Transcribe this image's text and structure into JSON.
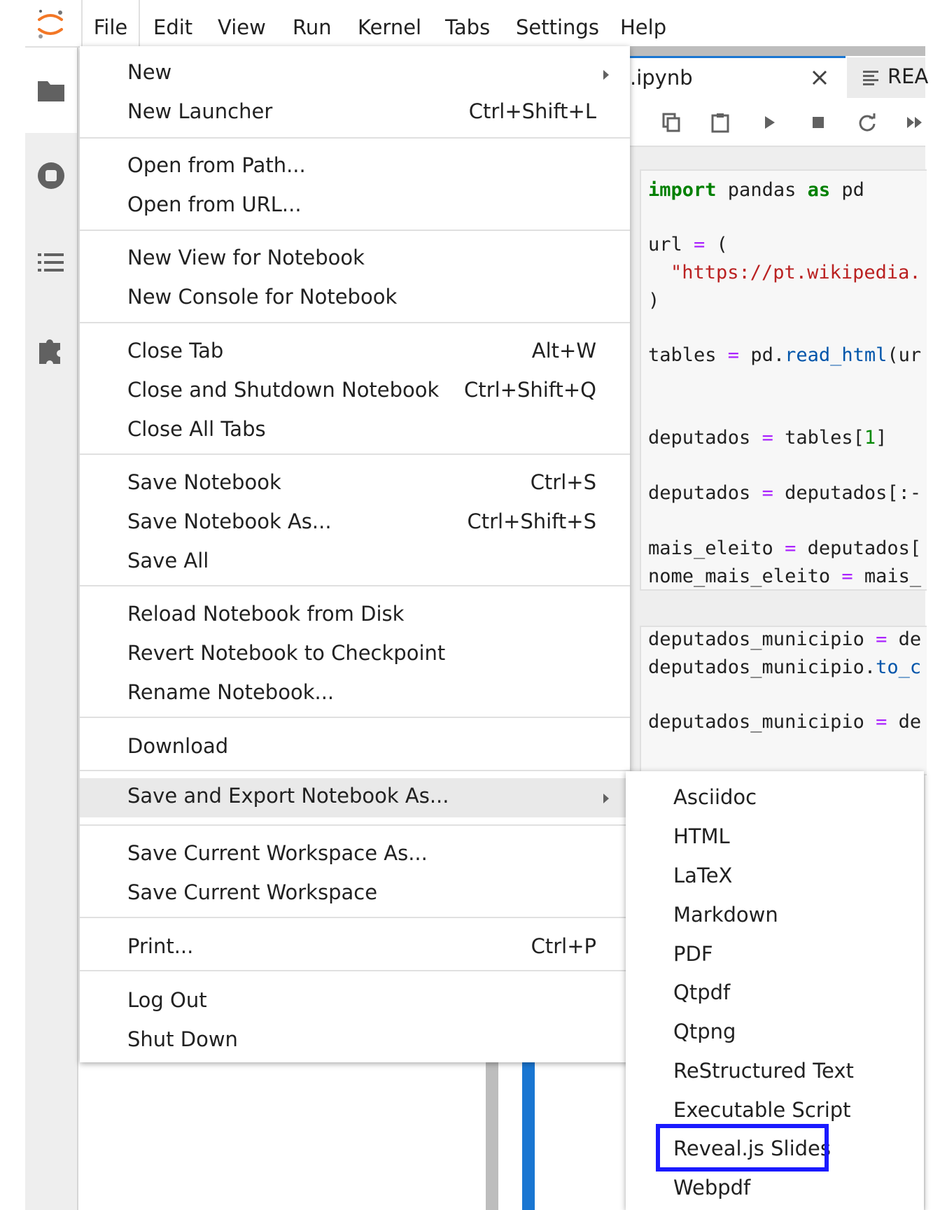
{
  "menubar": {
    "items": [
      "File",
      "Edit",
      "View",
      "Run",
      "Kernel",
      "Tabs",
      "Settings",
      "Help"
    ]
  },
  "tabs": [
    {
      "label": ".ipynb"
    },
    {
      "label": "REA"
    }
  ],
  "code": {
    "c1": {
      "l1": [
        "import",
        " pandas ",
        "as",
        " pd"
      ],
      "l2": [
        "url ",
        "=",
        " ("
      ],
      "l3": "\"https://pt.wikipedia.",
      "l4": ")",
      "l5": [
        "tables ",
        "=",
        " pd.",
        "read_html",
        "(ur"
      ],
      "l6": [
        "deputados ",
        "=",
        " tables[",
        "1",
        "]"
      ],
      "l7": [
        "deputados ",
        "=",
        " deputados[:-"
      ],
      "l8": [
        "mais_eleito ",
        "=",
        " deputados["
      ],
      "l9": [
        "nome_mais_eleito ",
        "=",
        " mais_"
      ]
    },
    "c2": {
      "l1": [
        "deputados_municipio ",
        "=",
        " de"
      ],
      "l2": [
        "deputados_municipio.",
        "to_c"
      ],
      "l3": [
        "deputados_municipio ",
        "=",
        " de"
      ]
    }
  },
  "file_menu": {
    "new": "New",
    "new_launcher": "New Launcher",
    "new_launcher_sc": "Ctrl+Shift+L",
    "open_path": "Open from Path...",
    "open_url": "Open from URL...",
    "new_view": "New View for Notebook",
    "new_console": "New Console for Notebook",
    "close_tab": "Close Tab",
    "close_tab_sc": "Alt+W",
    "close_shutdown": "Close and Shutdown Notebook",
    "close_shutdown_sc": "Ctrl+Shift+Q",
    "close_all": "Close All Tabs",
    "save_nb": "Save Notebook",
    "save_nb_sc": "Ctrl+S",
    "save_as": "Save Notebook As...",
    "save_as_sc": "Ctrl+Shift+S",
    "save_all": "Save All",
    "reload": "Reload Notebook from Disk",
    "revert": "Revert Notebook to Checkpoint",
    "rename": "Rename Notebook...",
    "download": "Download",
    "export": "Save and Export Notebook As...",
    "save_ws_as": "Save Current Workspace As...",
    "save_ws": "Save Current Workspace",
    "print": "Print...",
    "print_sc": "Ctrl+P",
    "logout": "Log Out",
    "shutdown": "Shut Down"
  },
  "export_menu": [
    "Asciidoc",
    "HTML",
    "LaTeX",
    "Markdown",
    "PDF",
    "Qtpdf",
    "Qtpng",
    "ReStructured Text",
    "Executable Script",
    "Reveal.js Slides",
    "Webpdf"
  ],
  "colors": {
    "accent": "#1976d2",
    "highlight_box": "#1a1aff",
    "logo_orange": "#f37726"
  },
  "icons": {
    "sidebar": [
      "folder-icon",
      "running-icon",
      "toc-icon",
      "extension-icon"
    ],
    "toolbar": [
      "copy-icon",
      "paste-icon",
      "run-icon",
      "stop-icon",
      "restart-icon",
      "fast-forward-icon"
    ]
  }
}
